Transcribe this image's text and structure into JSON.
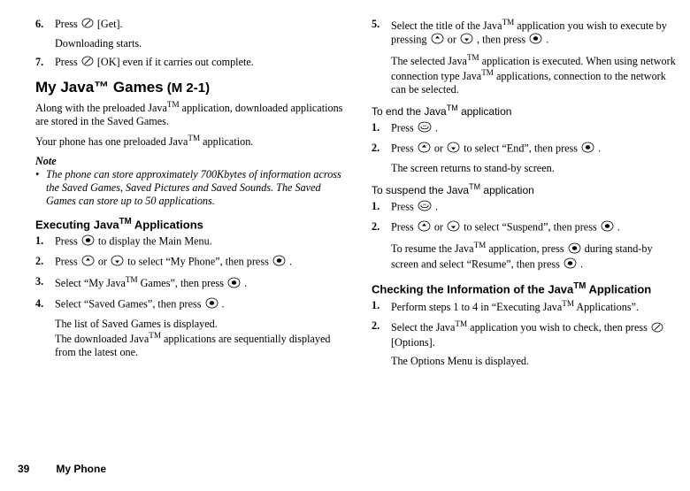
{
  "tm": "TM",
  "trade": "™",
  "left": {
    "step6_num": "6.",
    "step6_a": "Press ",
    "step6_b": " [Get].",
    "step6_sub": "Downloading starts.",
    "step7_num": "7.",
    "step7_a": "Press ",
    "step7_b": " [OK] even if it carries out complete.",
    "title_a": "My Java",
    "title_b": " Games",
    "mref": " (M 2-1)",
    "intro_a": "Along with the preloaded Java",
    "intro_b": " application, downloaded applications are stored in the Saved Games.",
    "intro2_a": "Your phone has one preloaded Java",
    "intro2_b": " application.",
    "note_label": "Note",
    "note_body": "The phone can store approximately 700Kbytes of information across the Saved Games, Saved Pictures and Saved Sounds. The Saved Games can store up to 50 applications.",
    "exec_a": "Executing Java",
    "exec_b": " Applications",
    "e1_num": "1.",
    "e1_a": "Press ",
    "e1_b": " to display the Main Menu.",
    "e2_num": "2.",
    "e2_a": "Press ",
    "e2_b": " or ",
    "e2_c": " to select “My Phone”, then press ",
    "e2_d": ".",
    "e3_num": "3.",
    "e3_a": "Select “My Java",
    "e3_b": " Games”, then press ",
    "e3_c": ".",
    "e4_num": "4.",
    "e4_a": "Select “Saved Games”, then press ",
    "e4_b": ".",
    "e4_sub1": "The list of Saved Games is displayed.",
    "e4_sub2a": "The downloaded Java",
    "e4_sub2b": " applications are sequentially displayed from the latest one."
  },
  "right": {
    "s5_num": "5.",
    "s5_a": "Select the title of the Java",
    "s5_b": " application you wish to execute by pressing ",
    "s5_c": " or ",
    "s5_d": ", then press ",
    "s5_e": ".",
    "s5_sub1a": "The selected Java",
    "s5_sub1b": " application is executed.",
    "s5_sub2a": "When using network connection type Java",
    "s5_sub2b": " applications, connection to the network can be selected.",
    "end_a": "To end the Java",
    "end_b": " application",
    "end1_num": "1.",
    "end1_a": "Press ",
    "end1_b": ".",
    "end2_num": "2.",
    "end2_a": "Press ",
    "end2_b": " or ",
    "end2_c": " to select “End”, then press ",
    "end2_d": ".",
    "end2_sub": "The screen returns to stand-by screen.",
    "sus_a": "To suspend the Java",
    "sus_b": " application",
    "sus1_num": "1.",
    "sus1_a": "Press ",
    "sus1_b": ".",
    "sus2_num": "2.",
    "sus2_a": "Press ",
    "sus2_b": " or ",
    "sus2_c": " to select “Suspend”, then press ",
    "sus2_d": ".",
    "sus2_sub1a": "To resume the Java",
    "sus2_sub1b": " application, press ",
    "sus2_sub1c": " during stand-by screen and select “Resume”, then press ",
    "sus2_sub1d": ".",
    "chk_a": "Checking the Information of the Java",
    "chk_b": " Application",
    "c1_num": "1.",
    "c1_a": "Perform steps 1 to 4 in “Executing Java",
    "c1_b": " Applications”.",
    "c2_num": "2.",
    "c2_a": "Select the Java",
    "c2_b": " application you wish to check, then press ",
    "c2_c": " [Options].",
    "c2_sub": "The Options Menu is displayed."
  },
  "footer": {
    "page": "39",
    "section": "My Phone"
  }
}
